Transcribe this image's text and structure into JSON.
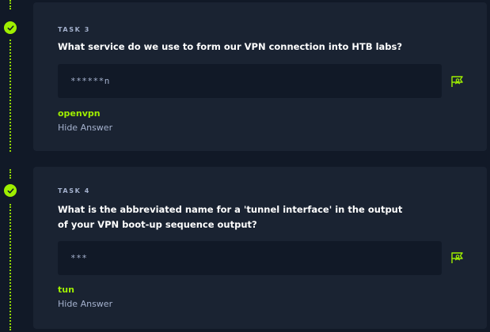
{
  "tasks": [
    {
      "label": "TASK 3",
      "question": "What service do we use to form our VPN connection into HTB labs?",
      "masked_answer": "******n",
      "answer": "openvpn",
      "toggle_label": "Hide Answer"
    },
    {
      "label": "TASK 4",
      "question": "What is the abbreviated name for a 'tunnel interface' in the output of your VPN boot-up sequence output?",
      "masked_answer": "***",
      "answer": "tun",
      "toggle_label": "Hide Answer"
    }
  ],
  "colors": {
    "background": "#111927",
    "card": "#1a2332",
    "accent": "#9fef00",
    "muted_text": "#a4b1cd"
  },
  "icons": {
    "completed": "check-circle-icon",
    "submit": "flag-icon"
  }
}
